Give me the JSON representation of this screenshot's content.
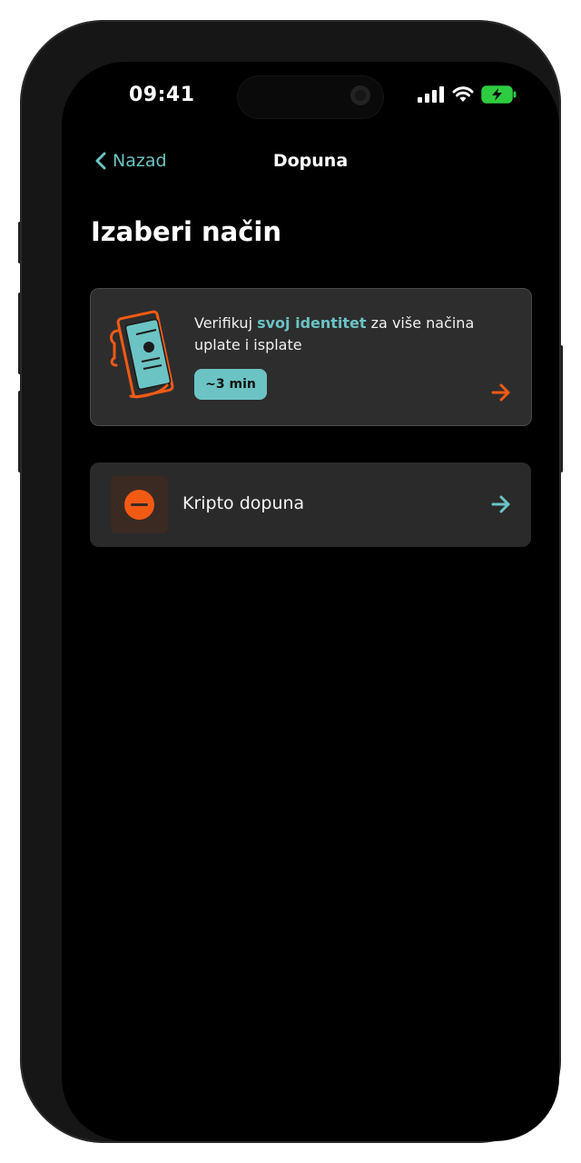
{
  "status_bar": {
    "time": "09:41"
  },
  "nav": {
    "back_label": "Nazad",
    "title": "Dopuna"
  },
  "page": {
    "title": "Izaberi način"
  },
  "verify_card": {
    "text_before": "Verifikuj ",
    "text_highlight": "svoj identitet",
    "text_after": " za više načina uplate i isplate",
    "badge": "~3 min"
  },
  "crypto_card": {
    "label": "Kripto dopuna"
  },
  "colors": {
    "accent": "#6cc3c4",
    "orange": "#f25a14",
    "background": "#000000",
    "card": "#2d2d2d"
  },
  "icons": [
    "chevron-left-icon",
    "signal-icon",
    "wifi-icon",
    "battery-charging-icon",
    "document-illustration",
    "arrow-right-icon",
    "crypto-icon"
  ]
}
